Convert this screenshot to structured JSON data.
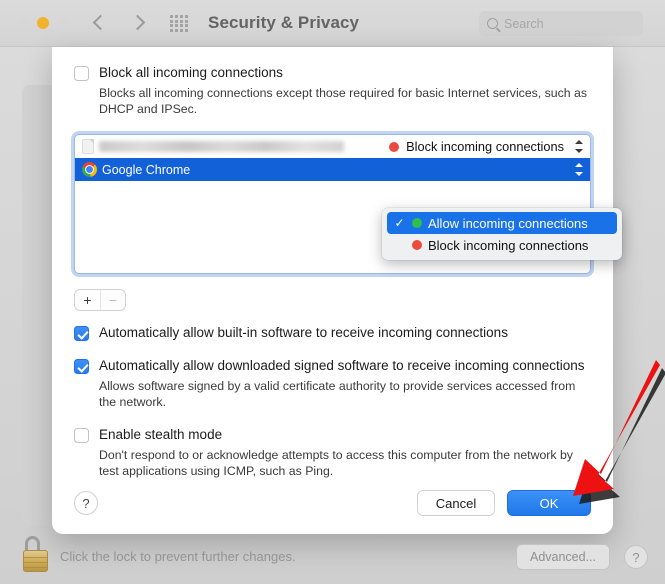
{
  "window": {
    "title": "Security & Privacy",
    "traffic_lights": [
      "close",
      "minimize",
      "maximize"
    ],
    "search": {
      "placeholder": "Search",
      "value": ""
    },
    "accent_color": "#2077ea",
    "minimize_color": "#f2b32c"
  },
  "sheet": {
    "block_all": {
      "label": "Block all incoming connections",
      "checked": false,
      "description": "Blocks all incoming connections except those required for basic Internet services, such as DHCP and IPSec."
    },
    "app_list": [
      {
        "name": "",
        "redacted": true,
        "state": "Block incoming connections",
        "state_color": "#ec4a3f",
        "selected": false
      },
      {
        "name": "Google Chrome",
        "redacted": false,
        "state": "Allow incoming connections",
        "state_color": "#2ec04a",
        "selected": true
      }
    ],
    "list_buttons": {
      "add": "+",
      "remove": "−"
    },
    "dropdown": {
      "open": true,
      "options": [
        {
          "label": "Allow incoming connections",
          "dot_color": "#2ec04a",
          "selected": true
        },
        {
          "label": "Block incoming connections",
          "dot_color": "#ec4a3f",
          "selected": false
        }
      ],
      "checkmark": "✓"
    },
    "builtin_software": {
      "label": "Automatically allow built-in software to receive incoming connections",
      "checked": true
    },
    "signed_software": {
      "label": "Automatically allow downloaded signed software to receive incoming connections",
      "checked": true,
      "description": "Allows software signed by a valid certificate authority to provide services accessed from the network."
    },
    "stealth_mode": {
      "label": "Enable stealth mode",
      "checked": false,
      "description": "Don't respond to or acknowledge attempts to access this computer from the network by test applications using ICMP, such as Ping."
    },
    "help_label": "?",
    "cancel_label": "Cancel",
    "ok_label": "OK"
  },
  "bottom_bar": {
    "lock_text": "Click the lock to prevent further changes.",
    "lock_state": "unlocked",
    "advanced_label": "Advanced...",
    "help_label": "?"
  },
  "annotation": {
    "type": "arrow",
    "color": "#ee1111",
    "points_to": "OK"
  }
}
